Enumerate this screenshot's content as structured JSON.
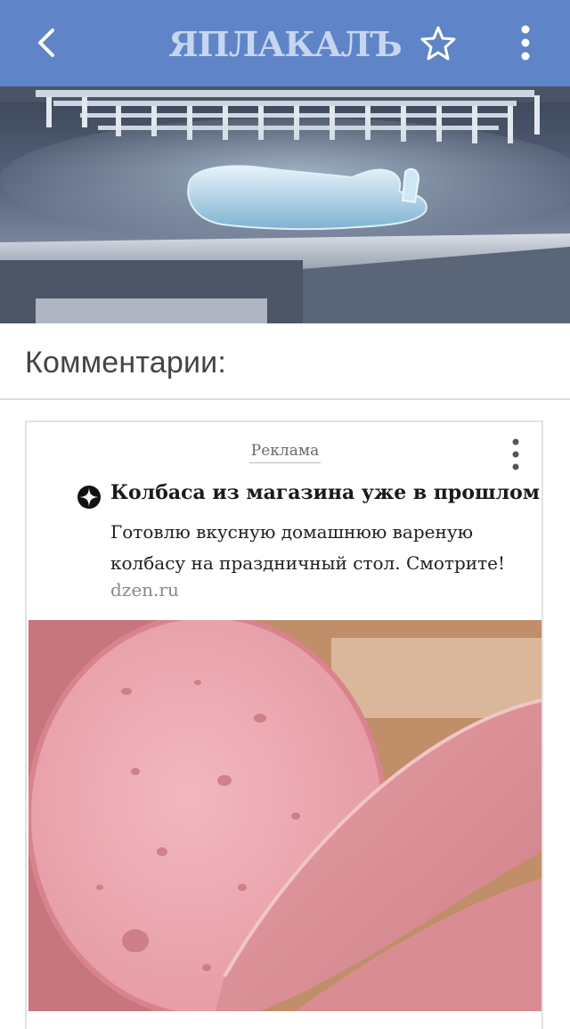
{
  "header": {
    "logo_text": "ЯПЛАКАЛЪ",
    "back_icon": "back-arrow-icon",
    "star_icon": "star-outline-icon",
    "more_icon": "more-vertical-icon",
    "bar_color": "#5f84c7"
  },
  "hero": {
    "description_icon": "frozen-body-image"
  },
  "comments": {
    "title": "Комментарии:"
  },
  "ad": {
    "label": "Реклама",
    "title": "Колбаса из магазина уже в прошлом",
    "text": "Готовлю вкусную домашнюю вареную колбасу на праздничный стол. Смотрите!",
    "domain": "dzen.ru",
    "menu_icon": "more-vertical-icon",
    "brand_icon": "dzen-icon"
  }
}
